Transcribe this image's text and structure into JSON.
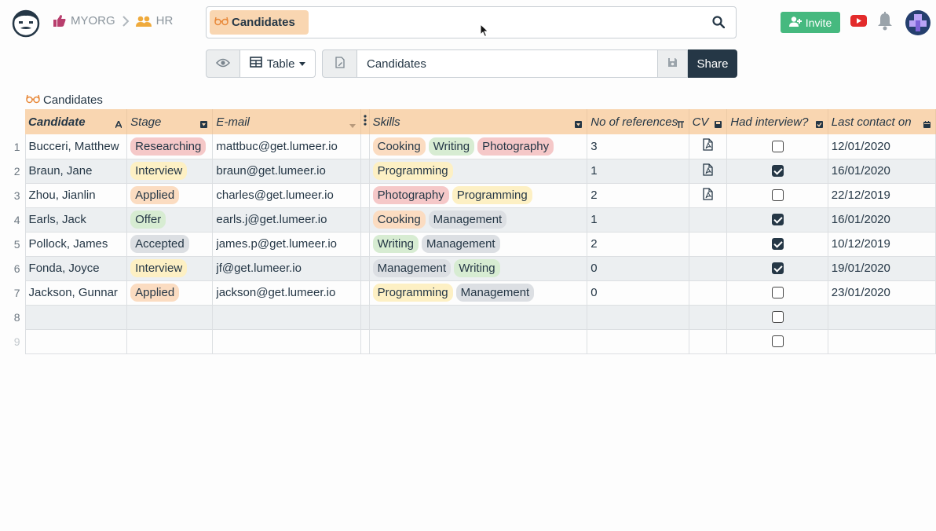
{
  "breadcrumb": {
    "org": "MYORG",
    "project": "HR"
  },
  "search": {
    "chip_label": "Candidates"
  },
  "header": {
    "invite_label": "Invite"
  },
  "toolbar": {
    "view_type": "Table",
    "view_name": "Candidates",
    "share_label": "Share"
  },
  "collection": {
    "name": "Candidates"
  },
  "columns": [
    "Candidate",
    "Stage",
    "E-mail",
    "Skills",
    "No of references",
    "CV",
    "Had interview?",
    "Last contact on"
  ],
  "colors": {
    "Researching": "#f5c8c8",
    "Interview": "#fdf0c4",
    "Applied": "#fbdcc1",
    "Offer": "#d7ecd2",
    "Accepted": "#dcdfe3",
    "Cooking": "#fbdcc1",
    "Writing": "#d7ecd2",
    "Photography": "#f5c8c8",
    "Programming": "#fdf0c4",
    "Management": "#dcdfe3"
  },
  "rows": [
    {
      "num": "1",
      "candidate": "Bucceri, Matthew",
      "stage": "Researching",
      "email": "mattbuc@get.lumeer.io",
      "skills": [
        "Cooking",
        "Writing",
        "Photography"
      ],
      "refs": "3",
      "cv": true,
      "interview": false,
      "contact": "12/01/2020"
    },
    {
      "num": "2",
      "candidate": "Braun, Jane",
      "stage": "Interview",
      "email": "braun@get.lumeer.io",
      "skills": [
        "Programming"
      ],
      "refs": "1",
      "cv": true,
      "interview": true,
      "contact": "16/01/2020"
    },
    {
      "num": "3",
      "candidate": "Zhou, Jianlin",
      "stage": "Applied",
      "email": "charles@get.lumeer.io",
      "skills": [
        "Photography",
        "Programming"
      ],
      "refs": "2",
      "cv": true,
      "interview": false,
      "contact": "22/12/2019"
    },
    {
      "num": "4",
      "candidate": "Earls, Jack",
      "stage": "Offer",
      "email": "earls.j@get.lumeer.io",
      "skills": [
        "Cooking",
        "Management"
      ],
      "refs": "1",
      "cv": false,
      "interview": true,
      "contact": "16/01/2020"
    },
    {
      "num": "5",
      "candidate": "Pollock, James",
      "stage": "Accepted",
      "email": "james.p@get.lumeer.io",
      "skills": [
        "Writing",
        "Management"
      ],
      "refs": "2",
      "cv": false,
      "interview": true,
      "contact": "10/12/2019"
    },
    {
      "num": "6",
      "candidate": "Fonda, Joyce",
      "stage": "Interview",
      "email": "jf@get.lumeer.io",
      "skills": [
        "Management",
        "Writing"
      ],
      "refs": "0",
      "cv": false,
      "interview": true,
      "contact": "19/01/2020"
    },
    {
      "num": "7",
      "candidate": "Jackson, Gunnar",
      "stage": "Applied",
      "email": "jackson@get.lumeer.io",
      "skills": [
        "Programming",
        "Management"
      ],
      "refs": "0",
      "cv": false,
      "interview": false,
      "contact": "23/01/2020"
    },
    {
      "num": "8",
      "candidate": "",
      "stage": "",
      "email": "",
      "skills": [],
      "refs": "",
      "cv": false,
      "interview": false,
      "contact": ""
    },
    {
      "num": "9",
      "candidate": "",
      "stage": "",
      "email": "",
      "skills": [],
      "refs": "",
      "cv": false,
      "interview": false,
      "contact": ""
    }
  ]
}
